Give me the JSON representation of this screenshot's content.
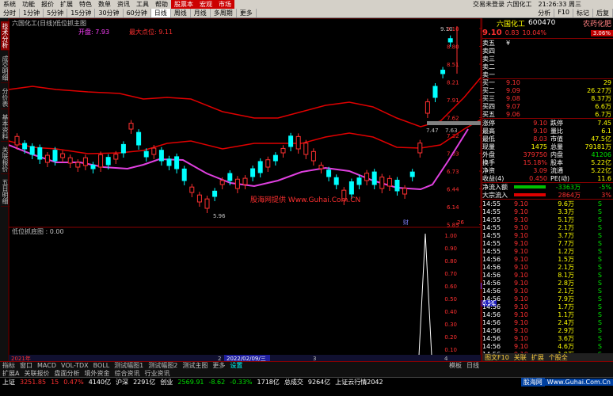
{
  "menu": [
    "系统",
    "功能",
    "报价",
    "扩展",
    "特色",
    "数单",
    "资讯",
    "工具",
    "帮助",
    "股票本",
    "宏观",
    "市场"
  ],
  "window_title": "交易未登录 六国化工",
  "clock": "21:26:33 周三",
  "toolbar": [
    "分时",
    "1分钟",
    "5分钟",
    "15分钟",
    "30分钟",
    "60分钟",
    "日线",
    "周线",
    "月线",
    "多周期",
    "更多"
  ],
  "toolbar_right": [
    "分析",
    "F10",
    "标记",
    "后复"
  ],
  "left_tabs": [
    "技术分析",
    "成交明细",
    "分价表",
    "基本资料",
    "关联报价",
    "五日明细"
  ],
  "chart": {
    "stock_label": "六国化工(日线)",
    "indicator": "低位抓主图",
    "legend1": "开盘: 7.93",
    "legend2": "最大点位: 9.11",
    "price_ticks": [
      "9.10",
      "8.80",
      "8.51",
      "8.21",
      "7.91",
      "7.62",
      "7.32",
      "7.03",
      "6.73",
      "6.44",
      "6.14",
      "5.85"
    ],
    "high_mark": "9.10",
    "low_mark": "5.96",
    "mid_mark": "7.47",
    "mid_mark2": "7.63",
    "watermark": "股海网提供 Www.Guhai.Com.CN",
    "sub_title": "低位抓底图 : 0.00",
    "sub_ticks": [
      "1.00",
      "0.90",
      "0.80",
      "0.70",
      "0.60",
      "0.50",
      "0.40",
      "0.30",
      "0.20",
      "0.10"
    ],
    "sub_cursor": "0.56",
    "year": "2021年",
    "date_label": "2022/02/09/三",
    "axis_marks": [
      "2",
      "3",
      "4"
    ],
    "markers": [
      "财",
      "26"
    ]
  },
  "tabs": [
    "指标",
    "窗口",
    "MACD",
    "VOL-TDX",
    "BOLL",
    "测试幅图1",
    "测试幅图2",
    "测试主图",
    "更多",
    "设置"
  ],
  "tabs_right": [
    "模板",
    "日线"
  ],
  "quote": {
    "name": "六国化工",
    "code": "600470",
    "mark": "农药化肥",
    "price": "9.10",
    "chg": "0.83",
    "pct": "10.04%",
    "pct2": "3.06%",
    "sells": [
      [
        "卖五",
        "¥"
      ],
      [
        "卖四",
        ""
      ],
      [
        "卖三",
        ""
      ],
      [
        "卖二",
        ""
      ],
      [
        "卖一",
        ""
      ]
    ],
    "buys": [
      [
        "买一",
        "9.10",
        "29"
      ],
      [
        "买二",
        "9.09",
        "26.27万"
      ],
      [
        "买三",
        "9.08",
        "8.37万"
      ],
      [
        "买四",
        "9.07",
        "6.6万"
      ],
      [
        "买五",
        "9.06",
        "6.7万"
      ]
    ],
    "stats": [
      [
        "涨停",
        "9.10",
        "跌停",
        "7.45"
      ],
      [
        "最高",
        "9.10",
        "量比",
        "6.1"
      ],
      [
        "最低",
        "8.03",
        "市值",
        "47.5亿"
      ],
      [
        "现量",
        "1475",
        "总量",
        "79181万"
      ],
      [
        "外盘",
        "379750",
        "内盘",
        "41206"
      ],
      [
        "换手",
        "15.18%",
        "股本",
        "5.22亿"
      ],
      [
        "净资",
        "3.09",
        "流通",
        "5.22亿"
      ],
      [
        "收益(4)",
        "0.450",
        "PE(动)",
        "11.6"
      ]
    ],
    "flows": [
      [
        "净流入额",
        "-3363万",
        "-5%"
      ],
      [
        "大宗流入",
        "2864万",
        "3%"
      ]
    ],
    "ticks": [
      [
        "14:55",
        "9.10",
        "9.6万",
        "S"
      ],
      [
        "14:55",
        "9.10",
        "3.3万",
        "S"
      ],
      [
        "14:55",
        "9.10",
        "5.1万",
        "S"
      ],
      [
        "14:55",
        "9.10",
        "2.1万",
        "S"
      ],
      [
        "14:55",
        "9.10",
        "3.7万",
        "S"
      ],
      [
        "14:55",
        "9.10",
        "7.7万",
        "S"
      ],
      [
        "14:55",
        "9.10",
        "1.2万",
        "S"
      ],
      [
        "14:56",
        "9.10",
        "1.5万",
        "S"
      ],
      [
        "14:56",
        "9.10",
        "2.1万",
        "S"
      ],
      [
        "14:56",
        "9.10",
        "8.1万",
        "S"
      ],
      [
        "14:56",
        "9.10",
        "2.8万",
        "S"
      ],
      [
        "14:56",
        "9.10",
        "2.1万",
        "S"
      ],
      [
        "14:56",
        "9.10",
        "7.9万",
        "S"
      ],
      [
        "14:56",
        "9.10",
        "1.7万",
        "S"
      ],
      [
        "14:56",
        "9.10",
        "1.1万",
        "S"
      ],
      [
        "14:56",
        "9.10",
        "2.4万",
        "S"
      ],
      [
        "14:56",
        "9.10",
        "2.9万",
        "S"
      ],
      [
        "14:56",
        "9.10",
        "3.6万",
        "S"
      ],
      [
        "14:56",
        "9.10",
        "4.6万",
        "S"
      ],
      [
        "14:56",
        "9.10",
        "1.9万",
        "S"
      ],
      [
        "14:56",
        "9.10",
        "2.5万",
        "S"
      ],
      [
        "14:57",
        "9.10",
        "4.4万",
        "S"
      ],
      [
        "15:00",
        "9.10",
        "134.2万",
        "S"
      ]
    ],
    "panel_tabs": [
      "图文F10",
      "关联",
      "扩展",
      "个股全"
    ]
  },
  "status": {
    "s1": "上证",
    "s1v": "3251.85",
    "s1c": "15",
    "s1p": "0.47%",
    "s1a": "4140亿",
    "s2": "沪深",
    "s2v": "2291亿",
    "s3": "创业",
    "s3v": "2569.91",
    "s3c": "-8.62",
    "s3p": "-0.33%",
    "s3a": "1718亿",
    "s4": "总成交",
    "s4v": "9264亿",
    "s5": "上证云行情2042",
    "logo": "股海网",
    "logo2": "Www.Guhai.Com.Cn",
    "ext": "扩展A",
    "ext_items": [
      "关联报价",
      "盘面分析",
      "境外资金",
      "综合资讯",
      "行业资讯"
    ]
  }
}
